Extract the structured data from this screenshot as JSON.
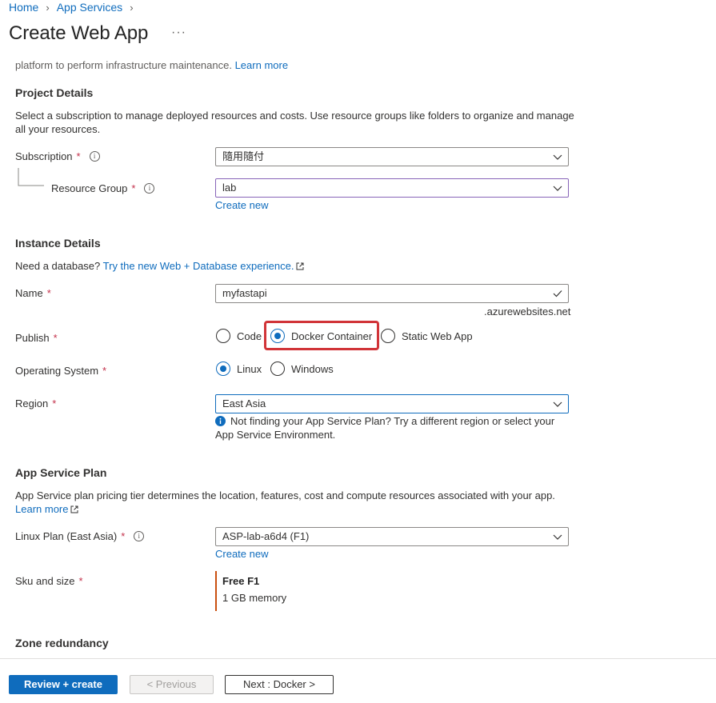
{
  "breadcrumb": {
    "home": "Home",
    "app_services": "App Services"
  },
  "page": {
    "title": "Create Web App",
    "more": "···"
  },
  "clipped_intro": {
    "text": "platform to perform infrastructure maintenance.",
    "link": "Learn more"
  },
  "project_details": {
    "title": "Project Details",
    "description": "Select a subscription to manage deployed resources and costs. Use resource groups like folders to organize and manage",
    "description_line2": "all your resources.",
    "subscription_label": "Subscription",
    "subscription_value": "隨用隨付",
    "resource_group_label": "Resource Group",
    "resource_group_value": "lab",
    "create_new": "Create new"
  },
  "instance_details": {
    "title": "Instance Details",
    "db_prompt": "Need a database?",
    "db_link": "Try the new Web + Database experience.",
    "name_label": "Name",
    "name_value": "myfastapi",
    "name_suffix": ".azurewebsites.net",
    "publish_label": "Publish",
    "publish_options": [
      "Code",
      "Docker Container",
      "Static Web App"
    ],
    "publish_selected": "Docker Container",
    "os_label": "Operating System",
    "os_options": [
      "Linux",
      "Windows"
    ],
    "os_selected": "Linux",
    "region_label": "Region",
    "region_value": "East Asia",
    "region_note_line1": "Not finding your App Service Plan? Try a different region or select your",
    "region_note_line2": "App Service Environment."
  },
  "app_service_plan": {
    "title": "App Service Plan",
    "description": "App Service plan pricing tier determines the location, features, cost and compute resources associated with your app.",
    "learn_more": "Learn more",
    "plan_label": "Linux Plan (East Asia)",
    "plan_value": "ASP-lab-a6d4 (F1)",
    "create_new": "Create new",
    "sku_label": "Sku and size",
    "sku_name": "Free F1",
    "sku_detail": "1 GB memory"
  },
  "zone_redundancy": {
    "title": "Zone redundancy"
  },
  "required_marker": "*",
  "info_glyph": "i",
  "footer": {
    "review_create": "Review + create",
    "previous": "< Previous",
    "next": "Next : Docker >"
  },
  "colors": {
    "accent": "#0f6cbd",
    "required": "#c4314b",
    "highlight": "#d13438",
    "sku_bar": "#ca5010"
  }
}
